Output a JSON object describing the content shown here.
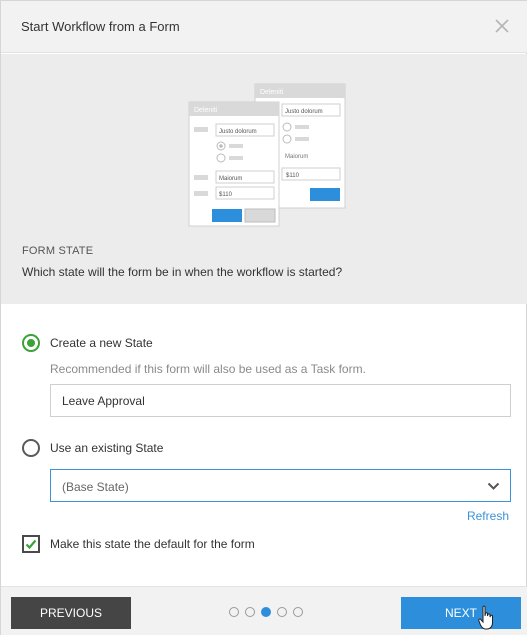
{
  "header": {
    "title": "Start Workflow from a Form",
    "close_icon": "close-icon"
  },
  "illustration": {
    "back_form": {
      "title": "Deleniti",
      "field1": "Justo dolorum",
      "label": "Maiorum",
      "field2": "$110"
    },
    "front_form": {
      "title": "Deleniti",
      "field1": "Justo dolorum",
      "field2": "Maiorum",
      "field3": "$110"
    }
  },
  "section": {
    "caption": "FORM STATE",
    "question": "Which state will the form be in when the workflow is started?"
  },
  "options": {
    "new_state": {
      "label": "Create a new State",
      "selected": true,
      "hint": "Recommended if this form will also be used as a Task form.",
      "input_value": "Leave Approval"
    },
    "existing_state": {
      "label": "Use an existing State",
      "selected": false,
      "select_value": "(Base State)",
      "refresh_label": "Refresh"
    }
  },
  "default_checkbox": {
    "label": "Make this state the default for the form",
    "checked": true
  },
  "footer": {
    "previous_label": "PREVIOUS",
    "next_label": "NEXT",
    "pagination": {
      "total": 5,
      "current": 3
    }
  },
  "colors": {
    "accent": "#2d8fdb",
    "selected_green": "#3aa236",
    "dark_button": "#454545"
  }
}
